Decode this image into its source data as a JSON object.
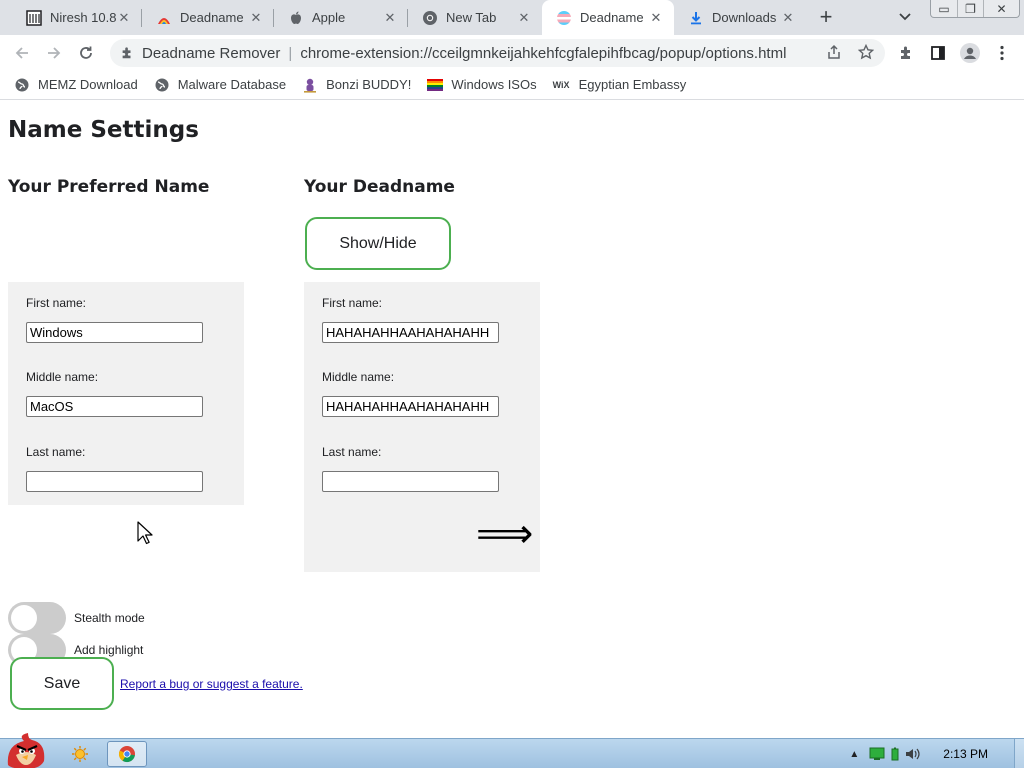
{
  "tabs": [
    {
      "title": "Niresh 10.8.",
      "icon": "archive-icon",
      "active": false
    },
    {
      "title": "Deadname",
      "icon": "deadname-remover-icon",
      "active": false
    },
    {
      "title": "Apple",
      "icon": "apple-icon",
      "active": false
    },
    {
      "title": "New Tab",
      "icon": "chrome-icon",
      "active": false
    },
    {
      "title": "Deadname",
      "icon": "trans-flag-icon",
      "active": true
    },
    {
      "title": "Downloads",
      "icon": "download-icon",
      "active": false
    }
  ],
  "new_tab_label": "+",
  "window_controls": {
    "minimize": "▭",
    "restore": "❐",
    "close": "✕"
  },
  "address_bar": {
    "site_name": "Deadname Remover",
    "divider": "|",
    "url": "chrome-extension://cceilgmnkeijahkehfcgfalepihfbcag/popup/options.html"
  },
  "bookmarks": [
    {
      "label": "MEMZ Download",
      "icon": "globe-icon"
    },
    {
      "label": "Malware Database",
      "icon": "globe-icon"
    },
    {
      "label": "Bonzi BUDDY!",
      "icon": "bonzi-icon"
    },
    {
      "label": "Windows ISOs",
      "icon": "pride-flag-icon"
    },
    {
      "label": "Egyptian Embassy",
      "icon": "wix-icon"
    }
  ],
  "bookmark_wix_text": "WiX",
  "page": {
    "title": "Name Settings",
    "preferred_heading": "Your Preferred Name",
    "deadname_heading": "Your Deadname",
    "show_hide_label": "Show/Hide",
    "preferred": {
      "first_label": "First name:",
      "first_value": "Windows",
      "middle_label": "Middle name:",
      "middle_value": "MacOS",
      "last_label": "Last name:",
      "last_value": ""
    },
    "deadname": {
      "first_label": "First name:",
      "first_value": "HAHAHAHHAAHAHAHAHH",
      "middle_label": "Middle name:",
      "middle_value": "HAHAHAHHAAHAHAHAHH",
      "last_label": "Last name:",
      "last_value": ""
    },
    "arrow_glyph": "⟹",
    "stealth_label": "Stealth mode",
    "stealth_on": false,
    "highlight_label": "Add highlight",
    "highlight_on": false,
    "save_label": "Save",
    "report_link": "Report a bug or suggest a feature."
  },
  "colors": {
    "accent_green": "#4caf50",
    "panel_bg": "#f1f1f1",
    "toggle_off": "#cccccc",
    "link": "#1a0dab"
  },
  "taskbar": {
    "apps": [
      "angry-bird-start-icon",
      "sun-icon",
      "chrome-icon"
    ],
    "clock": "2:13 PM"
  }
}
